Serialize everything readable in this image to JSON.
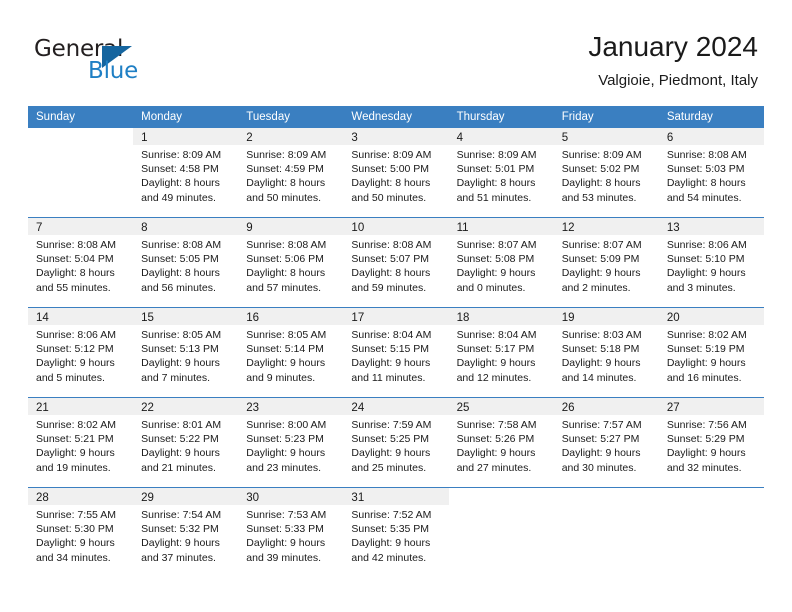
{
  "brand": {
    "name_top": "General",
    "name_bottom": "Blue",
    "accent_color": "#1f7fc4",
    "triangle_color": "#15659f"
  },
  "header": {
    "title": "January 2024",
    "subtitle": "Valgioie, Piedmont, Italy"
  },
  "calendar": {
    "header_bg": "#3a7fc1",
    "daynum_band_bg": "#f0f0f0",
    "weekdays": [
      "Sunday",
      "Monday",
      "Tuesday",
      "Wednesday",
      "Thursday",
      "Friday",
      "Saturday"
    ],
    "weeks": [
      [
        {
          "day": "",
          "sunrise": "",
          "sunset": "",
          "daylight1": "",
          "daylight2": ""
        },
        {
          "day": "1",
          "sunrise": "Sunrise: 8:09 AM",
          "sunset": "Sunset: 4:58 PM",
          "daylight1": "Daylight: 8 hours",
          "daylight2": "and 49 minutes."
        },
        {
          "day": "2",
          "sunrise": "Sunrise: 8:09 AM",
          "sunset": "Sunset: 4:59 PM",
          "daylight1": "Daylight: 8 hours",
          "daylight2": "and 50 minutes."
        },
        {
          "day": "3",
          "sunrise": "Sunrise: 8:09 AM",
          "sunset": "Sunset: 5:00 PM",
          "daylight1": "Daylight: 8 hours",
          "daylight2": "and 50 minutes."
        },
        {
          "day": "4",
          "sunrise": "Sunrise: 8:09 AM",
          "sunset": "Sunset: 5:01 PM",
          "daylight1": "Daylight: 8 hours",
          "daylight2": "and 51 minutes."
        },
        {
          "day": "5",
          "sunrise": "Sunrise: 8:09 AM",
          "sunset": "Sunset: 5:02 PM",
          "daylight1": "Daylight: 8 hours",
          "daylight2": "and 53 minutes."
        },
        {
          "day": "6",
          "sunrise": "Sunrise: 8:08 AM",
          "sunset": "Sunset: 5:03 PM",
          "daylight1": "Daylight: 8 hours",
          "daylight2": "and 54 minutes."
        }
      ],
      [
        {
          "day": "7",
          "sunrise": "Sunrise: 8:08 AM",
          "sunset": "Sunset: 5:04 PM",
          "daylight1": "Daylight: 8 hours",
          "daylight2": "and 55 minutes."
        },
        {
          "day": "8",
          "sunrise": "Sunrise: 8:08 AM",
          "sunset": "Sunset: 5:05 PM",
          "daylight1": "Daylight: 8 hours",
          "daylight2": "and 56 minutes."
        },
        {
          "day": "9",
          "sunrise": "Sunrise: 8:08 AM",
          "sunset": "Sunset: 5:06 PM",
          "daylight1": "Daylight: 8 hours",
          "daylight2": "and 57 minutes."
        },
        {
          "day": "10",
          "sunrise": "Sunrise: 8:08 AM",
          "sunset": "Sunset: 5:07 PM",
          "daylight1": "Daylight: 8 hours",
          "daylight2": "and 59 minutes."
        },
        {
          "day": "11",
          "sunrise": "Sunrise: 8:07 AM",
          "sunset": "Sunset: 5:08 PM",
          "daylight1": "Daylight: 9 hours",
          "daylight2": "and 0 minutes."
        },
        {
          "day": "12",
          "sunrise": "Sunrise: 8:07 AM",
          "sunset": "Sunset: 5:09 PM",
          "daylight1": "Daylight: 9 hours",
          "daylight2": "and 2 minutes."
        },
        {
          "day": "13",
          "sunrise": "Sunrise: 8:06 AM",
          "sunset": "Sunset: 5:10 PM",
          "daylight1": "Daylight: 9 hours",
          "daylight2": "and 3 minutes."
        }
      ],
      [
        {
          "day": "14",
          "sunrise": "Sunrise: 8:06 AM",
          "sunset": "Sunset: 5:12 PM",
          "daylight1": "Daylight: 9 hours",
          "daylight2": "and 5 minutes."
        },
        {
          "day": "15",
          "sunrise": "Sunrise: 8:05 AM",
          "sunset": "Sunset: 5:13 PM",
          "daylight1": "Daylight: 9 hours",
          "daylight2": "and 7 minutes."
        },
        {
          "day": "16",
          "sunrise": "Sunrise: 8:05 AM",
          "sunset": "Sunset: 5:14 PM",
          "daylight1": "Daylight: 9 hours",
          "daylight2": "and 9 minutes."
        },
        {
          "day": "17",
          "sunrise": "Sunrise: 8:04 AM",
          "sunset": "Sunset: 5:15 PM",
          "daylight1": "Daylight: 9 hours",
          "daylight2": "and 11 minutes."
        },
        {
          "day": "18",
          "sunrise": "Sunrise: 8:04 AM",
          "sunset": "Sunset: 5:17 PM",
          "daylight1": "Daylight: 9 hours",
          "daylight2": "and 12 minutes."
        },
        {
          "day": "19",
          "sunrise": "Sunrise: 8:03 AM",
          "sunset": "Sunset: 5:18 PM",
          "daylight1": "Daylight: 9 hours",
          "daylight2": "and 14 minutes."
        },
        {
          "day": "20",
          "sunrise": "Sunrise: 8:02 AM",
          "sunset": "Sunset: 5:19 PM",
          "daylight1": "Daylight: 9 hours",
          "daylight2": "and 16 minutes."
        }
      ],
      [
        {
          "day": "21",
          "sunrise": "Sunrise: 8:02 AM",
          "sunset": "Sunset: 5:21 PM",
          "daylight1": "Daylight: 9 hours",
          "daylight2": "and 19 minutes."
        },
        {
          "day": "22",
          "sunrise": "Sunrise: 8:01 AM",
          "sunset": "Sunset: 5:22 PM",
          "daylight1": "Daylight: 9 hours",
          "daylight2": "and 21 minutes."
        },
        {
          "day": "23",
          "sunrise": "Sunrise: 8:00 AM",
          "sunset": "Sunset: 5:23 PM",
          "daylight1": "Daylight: 9 hours",
          "daylight2": "and 23 minutes."
        },
        {
          "day": "24",
          "sunrise": "Sunrise: 7:59 AM",
          "sunset": "Sunset: 5:25 PM",
          "daylight1": "Daylight: 9 hours",
          "daylight2": "and 25 minutes."
        },
        {
          "day": "25",
          "sunrise": "Sunrise: 7:58 AM",
          "sunset": "Sunset: 5:26 PM",
          "daylight1": "Daylight: 9 hours",
          "daylight2": "and 27 minutes."
        },
        {
          "day": "26",
          "sunrise": "Sunrise: 7:57 AM",
          "sunset": "Sunset: 5:27 PM",
          "daylight1": "Daylight: 9 hours",
          "daylight2": "and 30 minutes."
        },
        {
          "day": "27",
          "sunrise": "Sunrise: 7:56 AM",
          "sunset": "Sunset: 5:29 PM",
          "daylight1": "Daylight: 9 hours",
          "daylight2": "and 32 minutes."
        }
      ],
      [
        {
          "day": "28",
          "sunrise": "Sunrise: 7:55 AM",
          "sunset": "Sunset: 5:30 PM",
          "daylight1": "Daylight: 9 hours",
          "daylight2": "and 34 minutes."
        },
        {
          "day": "29",
          "sunrise": "Sunrise: 7:54 AM",
          "sunset": "Sunset: 5:32 PM",
          "daylight1": "Daylight: 9 hours",
          "daylight2": "and 37 minutes."
        },
        {
          "day": "30",
          "sunrise": "Sunrise: 7:53 AM",
          "sunset": "Sunset: 5:33 PM",
          "daylight1": "Daylight: 9 hours",
          "daylight2": "and 39 minutes."
        },
        {
          "day": "31",
          "sunrise": "Sunrise: 7:52 AM",
          "sunset": "Sunset: 5:35 PM",
          "daylight1": "Daylight: 9 hours",
          "daylight2": "and 42 minutes."
        },
        {
          "day": "",
          "sunrise": "",
          "sunset": "",
          "daylight1": "",
          "daylight2": ""
        },
        {
          "day": "",
          "sunrise": "",
          "sunset": "",
          "daylight1": "",
          "daylight2": ""
        },
        {
          "day": "",
          "sunrise": "",
          "sunset": "",
          "daylight1": "",
          "daylight2": ""
        }
      ]
    ]
  }
}
